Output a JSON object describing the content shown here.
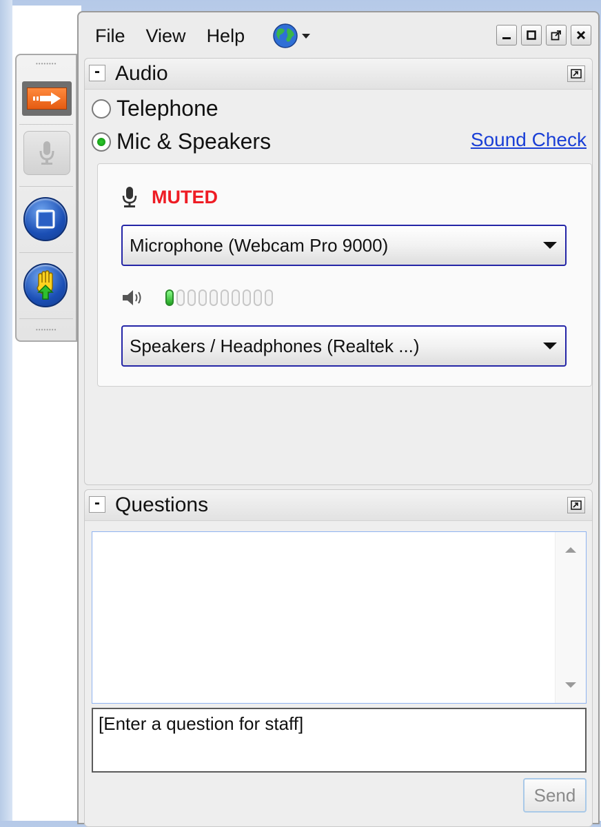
{
  "menu": {
    "file": "File",
    "view": "View",
    "help": "Help"
  },
  "window_controls": {
    "minimize": "_",
    "maximize": "□",
    "popout": "⧉",
    "close": "✕"
  },
  "audio_panel": {
    "title": "Audio",
    "options": [
      {
        "label": "Telephone",
        "selected": false
      },
      {
        "label": "Mic & Speakers",
        "selected": true
      }
    ],
    "sound_check": "Sound Check",
    "status": "MUTED",
    "microphone_device": "Microphone (Webcam Pro 9000)",
    "speaker_device": "Speakers / Headphones (Realtek ...)",
    "speaker_level_bars_total": 10,
    "speaker_level_bars_lit": 1
  },
  "questions_panel": {
    "title": "Questions",
    "input_placeholder": "[Enter a question for staff]",
    "send_label": "Send"
  },
  "icons": {
    "globe": "globe-icon",
    "arrow": "arrow-right-icon",
    "microphone": "microphone-icon",
    "screen": "screen-icon",
    "raise_hand": "raise-hand-icon",
    "speaker": "speaker-icon",
    "collapse": "minus-icon",
    "popout": "popout-icon"
  },
  "colors": {
    "muted": "#ee1c24",
    "link": "#1a3fd6",
    "accent_orange": "#ff8a3d",
    "select_border": "#2324a6"
  }
}
